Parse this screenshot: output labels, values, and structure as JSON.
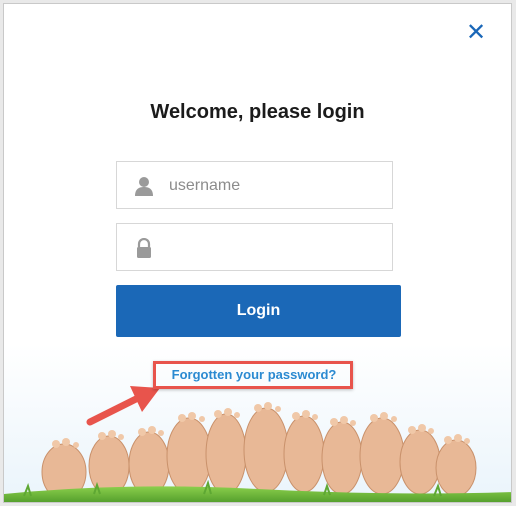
{
  "dialog": {
    "close_symbol": "✕",
    "title": "Welcome, please login",
    "username": {
      "value": "",
      "placeholder": "username",
      "icon": "user-icon"
    },
    "password": {
      "value": "",
      "placeholder": "",
      "icon": "lock-icon"
    },
    "login_label": "Login",
    "forgot_label": "Forgotten your password?"
  },
  "colors": {
    "accent": "#1b68b7",
    "link": "#2b8ad1",
    "highlight": "#e8544c",
    "grass": "#7cc242"
  }
}
